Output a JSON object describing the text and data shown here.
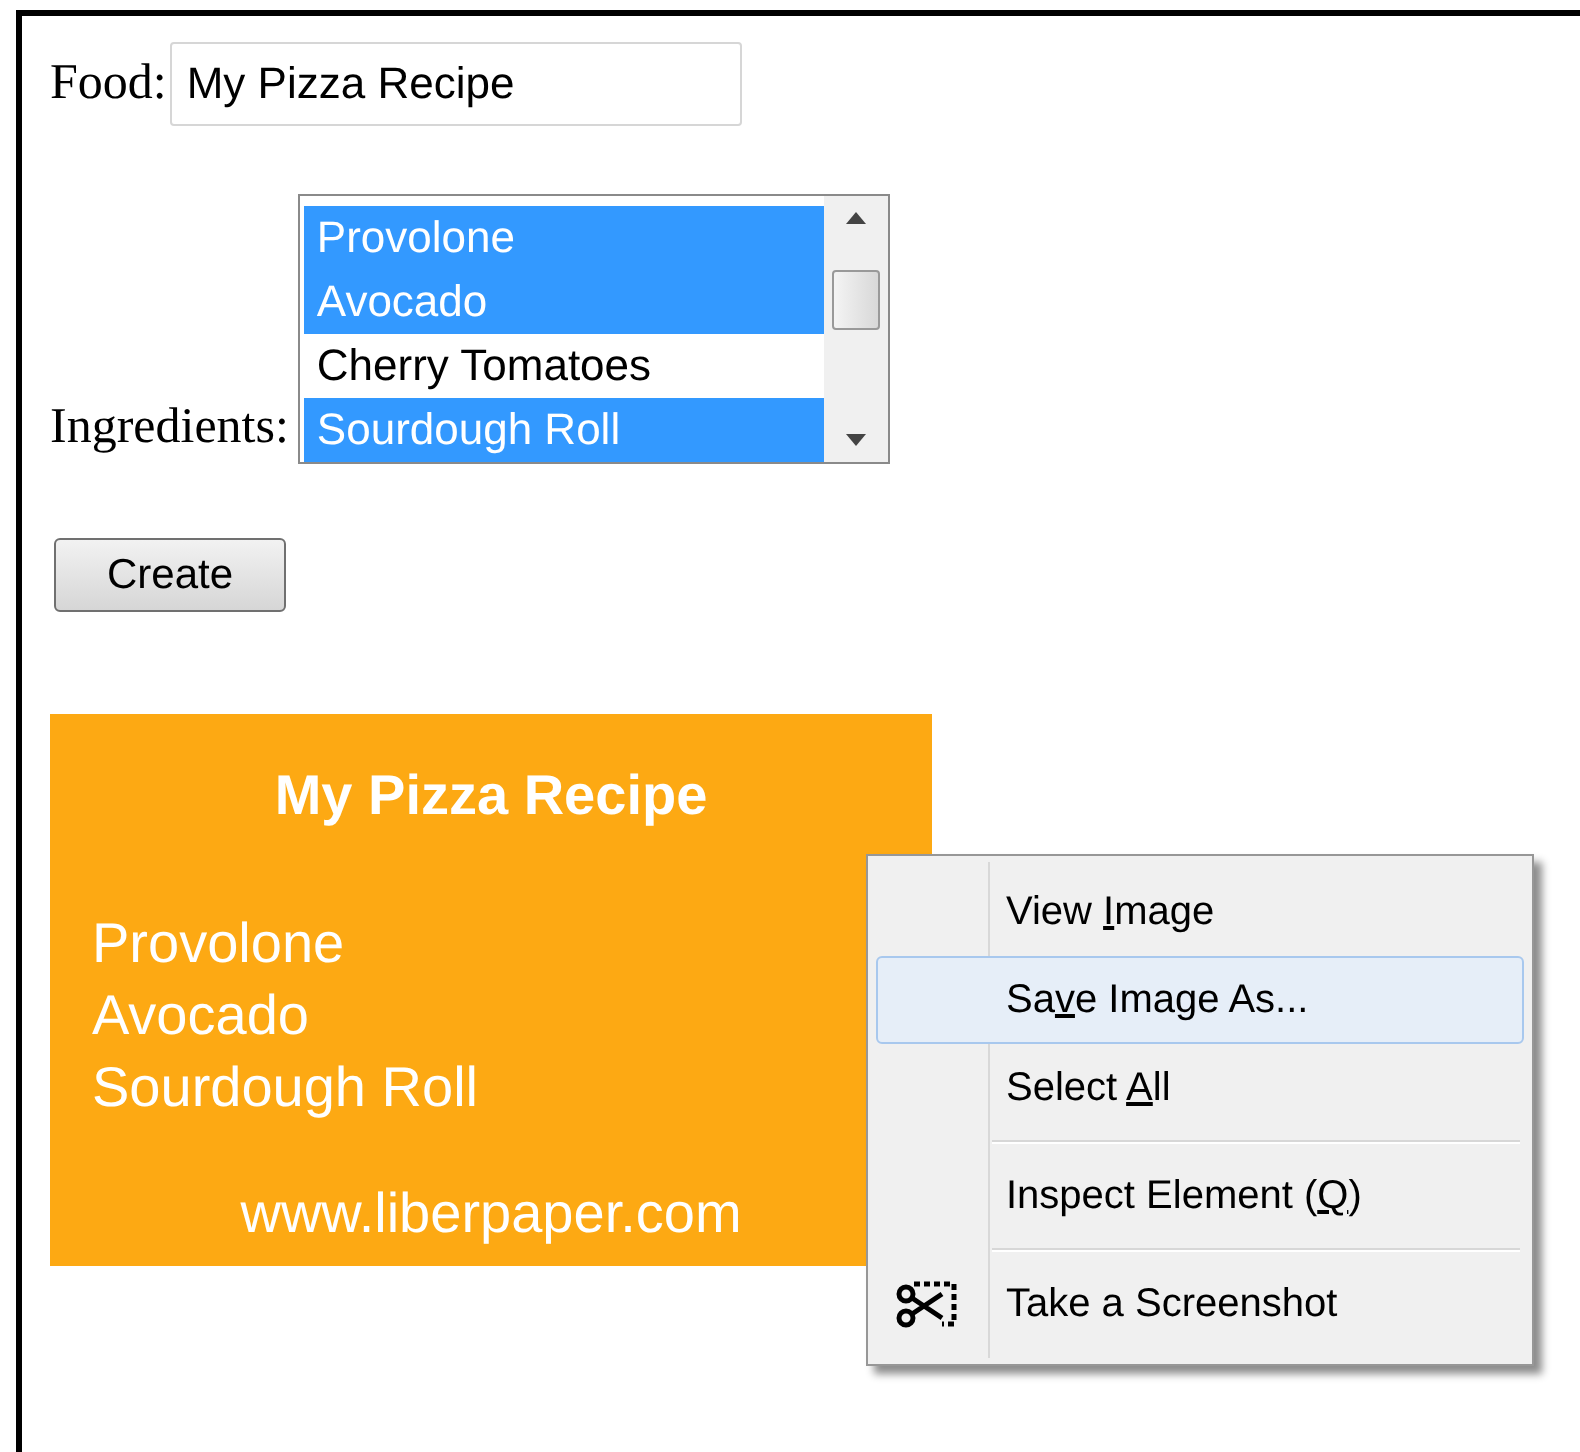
{
  "form": {
    "food_label": "Food:",
    "food_value": "My Pizza Recipe",
    "ingredients_label": "Ingredients:",
    "ingredients": [
      {
        "label": "Provolone",
        "selected": true
      },
      {
        "label": "Avocado",
        "selected": true
      },
      {
        "label": "Cherry Tomatoes",
        "selected": false
      },
      {
        "label": "Sourdough Roll",
        "selected": true
      }
    ],
    "create_button": "Create"
  },
  "recipe_card": {
    "title": "My Pizza Recipe",
    "items": [
      "Provolone",
      "Avocado",
      "Sourdough Roll"
    ],
    "footer": "www.liberpaper.com"
  },
  "context_menu": [
    {
      "kind": "item",
      "parts": [
        "View ",
        "I",
        "mage"
      ],
      "selected": false
    },
    {
      "kind": "item",
      "parts": [
        "Sa",
        "v",
        "e Image As..."
      ],
      "selected": true
    },
    {
      "kind": "item",
      "parts": [
        "Select ",
        "A",
        "ll"
      ],
      "selected": false
    },
    {
      "kind": "separator"
    },
    {
      "kind": "item",
      "parts": [
        "Inspect Element (",
        "Q",
        ")"
      ],
      "selected": false
    },
    {
      "kind": "separator"
    },
    {
      "kind": "screenshot",
      "parts": [
        "Take a Screenshot"
      ],
      "selected": false
    }
  ]
}
